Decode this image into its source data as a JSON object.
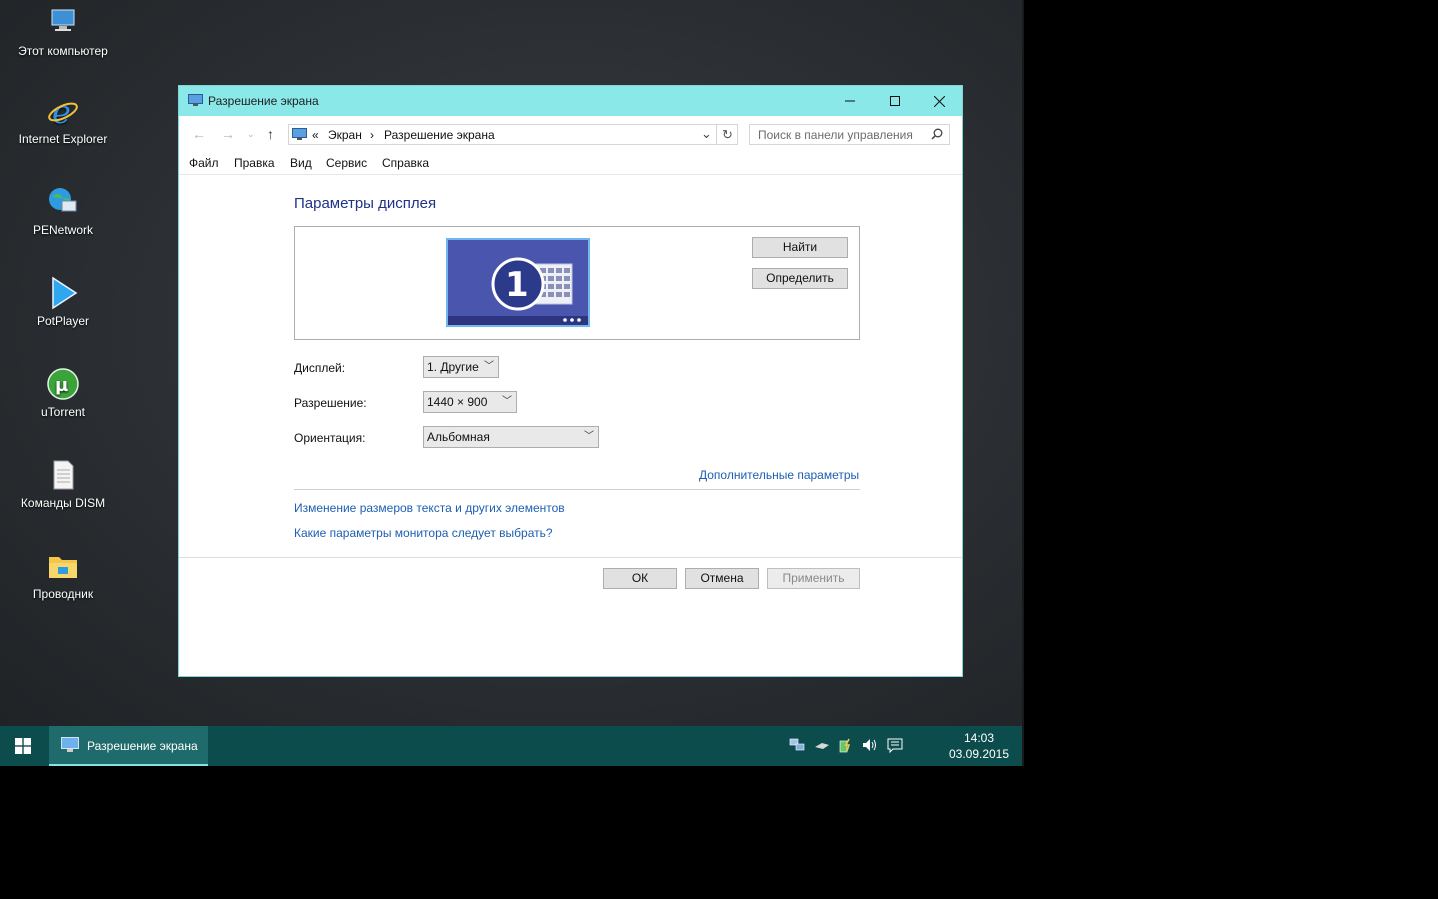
{
  "desktop": {
    "icons": [
      {
        "label": "Этот компьютер"
      },
      {
        "label": "Internet Explorer"
      },
      {
        "label": "PENetwork"
      },
      {
        "label": "PotPlayer"
      },
      {
        "label": "uTorrent"
      },
      {
        "label": "Команды DISM"
      },
      {
        "label": "Проводник"
      }
    ]
  },
  "window": {
    "title": "Разрешение экрана",
    "address": {
      "chevron": "«",
      "crumb1": "Экран",
      "separator": "›",
      "crumb2": "Разрешение экрана"
    },
    "search": {
      "placeholder": "Поиск в панели управления"
    },
    "menu": [
      "Файл",
      "Правка",
      "Вид",
      "Сервис",
      "Справка"
    ],
    "heading": "Параметры дисплея",
    "monitor_number": "1",
    "buttons": {
      "find": "Найти",
      "identify": "Определить"
    },
    "fields": {
      "display": {
        "label": "Дисплей:",
        "value": "1. Другие"
      },
      "resolution": {
        "label": "Разрешение:",
        "value": "1440 × 900"
      },
      "orientation": {
        "label": "Ориентация:",
        "value": "Альбомная"
      }
    },
    "advanced_link": "Дополнительные параметры",
    "links": {
      "text_size": "Изменение размеров текста и других элементов",
      "which_params": "Какие параметры монитора следует выбрать?"
    },
    "footer": {
      "ok": "ОК",
      "cancel": "Отмена",
      "apply": "Применить"
    }
  },
  "taskbar": {
    "task_label": "Разрешение экрана",
    "time": "14:03",
    "date": "03.09.2015"
  },
  "colors": {
    "titlebar": "#8ae8e8",
    "taskbar": "#0d4c4c",
    "link": "#1d5fb3",
    "heading": "#1e3287"
  }
}
